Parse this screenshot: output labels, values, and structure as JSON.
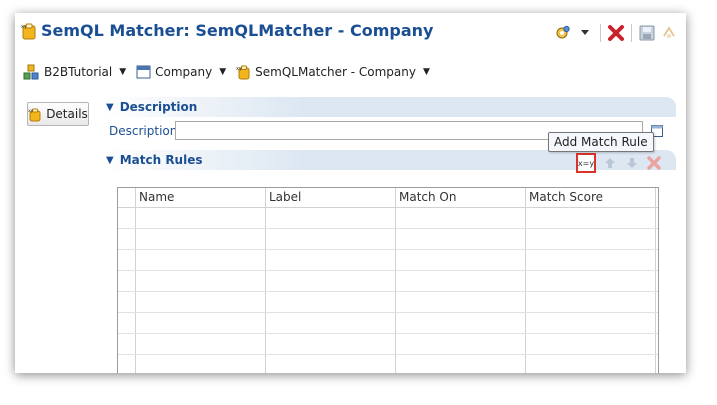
{
  "window": {
    "title": "SemQL Matcher: SemQLMatcher - Company",
    "actions": [
      "gear-dropdown-icon",
      "close-icon",
      "save-icon",
      "sync-icon"
    ]
  },
  "breadcrumb": [
    {
      "label": "B2BTutorial",
      "icon": "model-icon"
    },
    {
      "label": "Company",
      "icon": "entity-icon"
    },
    {
      "label": "SemQLMatcher - Company",
      "icon": "matcher-icon"
    }
  ],
  "nav": {
    "details_label": "Details"
  },
  "description_section": {
    "title": "Description",
    "field_label": "Description:",
    "field_value": ""
  },
  "match_rules_section": {
    "title": "Match Rules",
    "add_button_tooltip": "Add Match Rule",
    "add_button_glyph": "x=y",
    "columns": [
      "Name",
      "Label",
      "Match On",
      "Match Score"
    ],
    "rows": [
      [
        "",
        "",
        "",
        ""
      ],
      [
        "",
        "",
        "",
        ""
      ],
      [
        "",
        "",
        "",
        ""
      ],
      [
        "",
        "",
        "",
        ""
      ],
      [
        "",
        "",
        "",
        ""
      ],
      [
        "",
        "",
        "",
        ""
      ],
      [
        "",
        "",
        "",
        ""
      ],
      [
        "",
        "",
        "",
        ""
      ]
    ]
  },
  "colors": {
    "title_blue": "#1b4f93",
    "section_band": "#dde7f2",
    "highlight_red": "#d9342b",
    "close_red": "#c8232c"
  }
}
